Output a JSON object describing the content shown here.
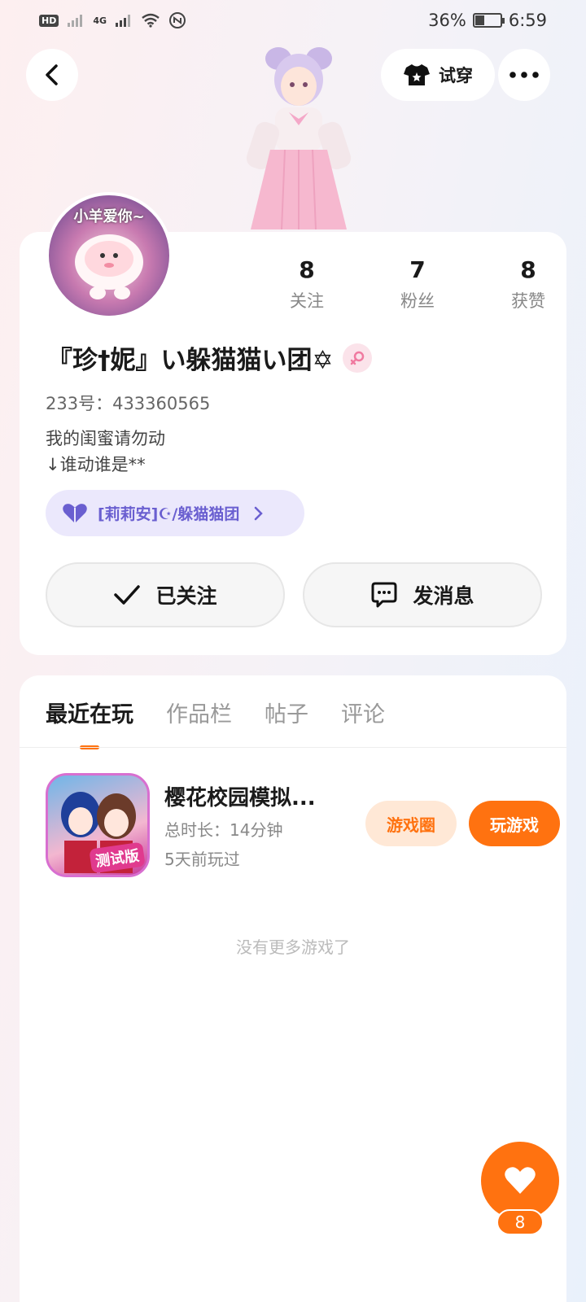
{
  "status_bar": {
    "network_badge": "HD",
    "signal_label": "4G",
    "battery_percent": "36%",
    "battery_level": 0.36,
    "time": "6:59"
  },
  "header": {
    "try_on_label": "试穿"
  },
  "profile": {
    "avatar_text": "小羊爱你~",
    "stats": [
      {
        "value": "8",
        "label": "关注"
      },
      {
        "value": "7",
        "label": "粉丝"
      },
      {
        "value": "8",
        "label": "获赞"
      }
    ],
    "nickname": "『珍†妮』い躲猫猫い团✡",
    "user_id": "233号：433360565",
    "bio_line1": "我的闺蜜请勿动",
    "bio_line2": "↓谁动谁是**",
    "group_name": "[莉莉安]☪/躲猫猫团",
    "follow_button": "已关注",
    "message_button": "发消息"
  },
  "tabs": [
    {
      "label": "最近在玩",
      "active": true
    },
    {
      "label": "作品栏",
      "active": false
    },
    {
      "label": "帖子",
      "active": false
    },
    {
      "label": "评论",
      "active": false
    }
  ],
  "games": [
    {
      "title": "樱花校园模拟...",
      "duration": "总时长：14分钟",
      "last_played": "5天前玩过",
      "icon_badge": "测试版",
      "circle_button": "游戏圈",
      "play_button": "玩游戏"
    }
  ],
  "no_more_text": "没有更多游戏了",
  "like": {
    "count": "8"
  },
  "colors": {
    "accent": "#ff7210",
    "group_chip_bg": "#ebe8fc",
    "group_chip_text": "#6a5fd0"
  }
}
